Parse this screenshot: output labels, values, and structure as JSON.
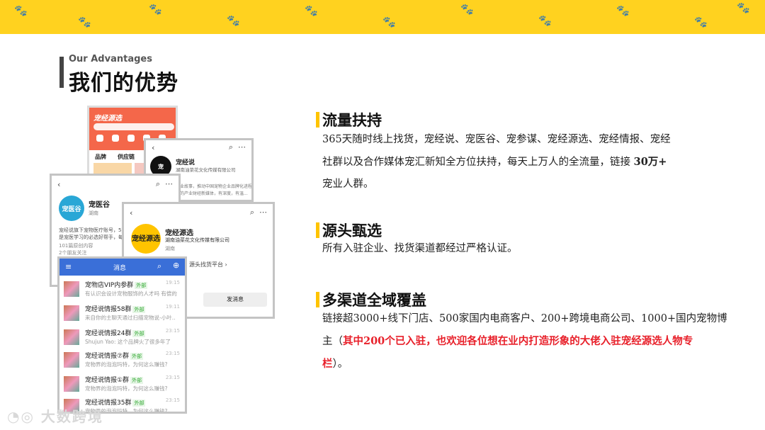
{
  "header": {
    "eyebrow": "Our Advantages",
    "title": "我们的优势"
  },
  "sections": [
    {
      "title": "流量扶持",
      "line1": "365天随时线上找货，宠经说、宠医谷、宠参谋、宠经源选、宠经情报、宠经",
      "line2a": "社群以及合作媒体宠汇新知全方位扶持，每天上万人的全流量，链接 ",
      "line2b": "30万+",
      "line3": "宠业人群。"
    },
    {
      "title": "源头甄选",
      "line1": "所有入驻企业、找货渠道都经过严格认证。"
    },
    {
      "title": "多渠道全域覆盖",
      "line1": "链接超3000+线下门店、500家国内电商客户、200+跨境电商公司、1000+国内宠物博",
      "line2a": "主（",
      "line2b": "其中200个已入驻，也欢迎各位想在业内打造形象的大佬入驻宠经源选人物专",
      "line3a": "栏",
      "line3b": "）。"
    }
  ],
  "screens": {
    "app": {
      "logo": "宠经源选",
      "tab1": "品牌",
      "tab2": "供应链"
    },
    "chongjingshuo": {
      "name": "宠经说",
      "company": "湖南油菜花文化传媒有限公司",
      "desc1": "企业故事，推动中国宠物企业品牌化进程。",
      "desc2": "办的产业财经新媒体，有深度，有温..."
    },
    "chongyigu": {
      "name": "宠医谷",
      "logo": "宠医谷",
      "region": "湖南",
      "desc1": "宠经说旗下宠物医疗账号，5万+",
      "desc2": "是宠医学习的必选好帮手，每个",
      "posts": "101篇原创内容",
      "friends": "2个朋友关注"
    },
    "chongjingyuanxuan": {
      "name": "宠经源选",
      "logo": "宠经源选",
      "company": "湖南油菜花文化传媒有限公司",
      "region": "湖南",
      "link": "源头找货平台",
      "send": "发消息"
    },
    "messages": {
      "title": "消息",
      "items": [
        {
          "name": "宠物店VIP内参群",
          "tag": "外部",
          "sub": "有认识会设计宠物服饰的人才吗 有偿的",
          "time": "19:15"
        },
        {
          "name": "宠经说情报58群",
          "tag": "外部",
          "sub": "来自你的主聊天通过扫描宠物说-小叶..",
          "time": "19:11"
        },
        {
          "name": "宠经说情报24群",
          "tag": "外部",
          "sub": "Shujun Yao: 这个品牌火了很多年了",
          "time": "23:15"
        },
        {
          "name": "宠经说情报⑦群",
          "tag": "外部",
          "sub": "宠物界的泡泡玛特，为何这么赚钱?",
          "time": "23:15"
        },
        {
          "name": "宠经说情报①群",
          "tag": "外部",
          "sub": "宠物界的泡泡玛特，为何这么赚钱?",
          "time": "23:15"
        },
        {
          "name": "宠经说情报35群",
          "tag": "外部",
          "sub": "宠物界的泡泡玛特，为何这么赚钱?",
          "time": "23:15"
        }
      ]
    }
  },
  "watermark": "大数跨境",
  "colors": {
    "banner": "#ffd21f",
    "accent_bar": "#ffc400",
    "highlight_red": "#e8202a",
    "app_orange": "#f4674a",
    "msg_header": "#3a6fd8"
  }
}
